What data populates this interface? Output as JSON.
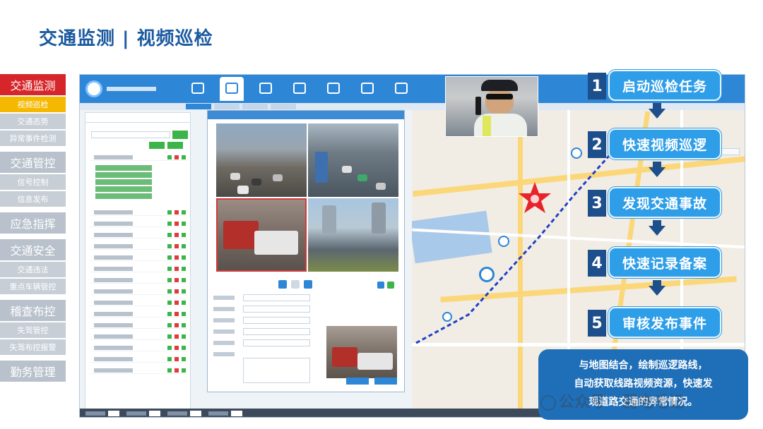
{
  "slide": {
    "title": "交通监测 | 视频巡检"
  },
  "left_nav": {
    "groups": [
      {
        "label": "交通监测",
        "active": true,
        "items": [
          {
            "label": "视频巡检",
            "active": true
          },
          {
            "label": "交通态势",
            "active": false
          },
          {
            "label": "异常事件检测",
            "active": false
          }
        ]
      },
      {
        "label": "交通管控",
        "active": false,
        "items": [
          {
            "label": "信号控制",
            "active": false
          },
          {
            "label": "信息发布",
            "active": false
          }
        ]
      },
      {
        "label": "应急指挥",
        "active": false,
        "items": []
      },
      {
        "label": "交通安全",
        "active": false,
        "items": [
          {
            "label": "交通违法",
            "active": false
          },
          {
            "label": "重点车辆管控",
            "active": false
          }
        ]
      },
      {
        "label": "稽查布控",
        "active": false,
        "items": [
          {
            "label": "失驾管控",
            "active": false
          },
          {
            "label": "失驾布控报警",
            "active": false
          }
        ]
      },
      {
        "label": "勤务管理",
        "active": false,
        "items": []
      }
    ]
  },
  "steps": [
    {
      "number": "1",
      "label": "启动巡检任务"
    },
    {
      "number": "2",
      "label": "快速视频巡逻"
    },
    {
      "number": "3",
      "label": "发现交通事故"
    },
    {
      "number": "4",
      "label": "快速记录备案"
    },
    {
      "number": "5",
      "label": "审核发布事件"
    }
  ],
  "info_box": {
    "line1": "与地图结合，绘制巡逻路线，",
    "line2": "自动获取线路视频资源，快速发",
    "line3": "现道路交通的异常情况。"
  },
  "watermark": {
    "text": "公众号 · 弱电毛记"
  },
  "colors": {
    "title_blue": "#1c5aa0",
    "nav_active_red": "#d7262a",
    "nav_sub_active_yellow": "#f5b800",
    "nav_inactive_gray": "#b9c2cc",
    "step_blue": "#2f9ee8",
    "step_number_navy": "#1d4f8c",
    "info_box_blue": "#1f6fb8",
    "app_header_blue": "#2d86d6",
    "route_blue": "#2140c8",
    "incident_red": "#e8242a"
  },
  "icons": {
    "app_logo": "police-badge-icon",
    "incident": "incident-star-icon",
    "camera": "camera-pin-icon"
  }
}
